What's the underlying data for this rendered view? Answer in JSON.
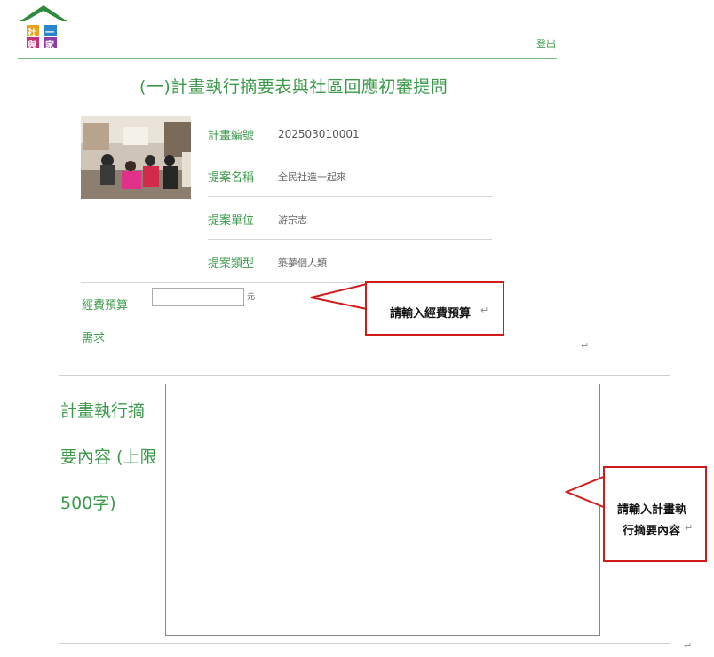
{
  "header": {
    "logo": {
      "chars": [
        "社",
        "一",
        "與",
        "家"
      ],
      "roof_color": "#2e8b3e"
    },
    "logout_label": "登出"
  },
  "page_title": "(一)計畫執行摘要表與社區回應初審提問",
  "project": {
    "fields": [
      {
        "label": "計畫編號",
        "value": "202503010001"
      },
      {
        "label": "提案名稱",
        "value": "全民社造一起來"
      },
      {
        "label": "提案單位",
        "value": "游宗志"
      },
      {
        "label": "提案類型",
        "value": "築夢個人類"
      }
    ]
  },
  "budget": {
    "label_line1": "經費預算",
    "label_line2": "需求",
    "value": "",
    "unit": "元"
  },
  "annotations": {
    "budget_callout": "請輸入經費預算",
    "summary_callout_line1": "請輸入計畫執",
    "summary_callout_line2": "行摘要內容",
    "return_mark": "↵",
    "accent_color": "#d11a1a"
  },
  "summary": {
    "label_line1": "計畫執行摘",
    "label_line2": "要內容 (上限",
    "label_line3": "500字)",
    "value": ""
  }
}
